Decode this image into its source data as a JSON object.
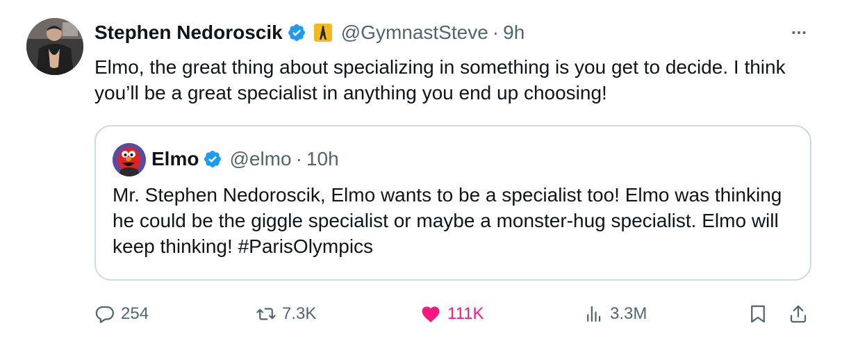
{
  "tweet": {
    "author": {
      "display_name": "Stephen Nedoroscik",
      "handle": "@GymnastSteve",
      "verified_icon": "verified-badge-icon",
      "affiliation_icon": "eiffel-tower-icon"
    },
    "separator": "·",
    "time": "9h",
    "more_icon": "more-horizontal-icon",
    "text": "Elmo, the great thing about specializing in something is you get to decide. I think you’ll be a great specialist in anything you end up choosing!"
  },
  "quoted_tweet": {
    "author": {
      "display_name": "Elmo",
      "handle": "@elmo",
      "verified_icon": "verified-badge-icon"
    },
    "separator": "·",
    "time": "10h",
    "text": "Mr. Stephen Nedoroscik, Elmo wants to be a specialist too! Elmo was thinking he could be the giggle specialist or maybe a monster-hug specialist. Elmo will keep thinking! #ParisOlympics"
  },
  "actions": {
    "reply": {
      "icon": "reply-icon",
      "count": "254"
    },
    "retweet": {
      "icon": "retweet-icon",
      "count": "7.3K"
    },
    "like": {
      "icon": "heart-filled-icon",
      "count": "111K",
      "liked": true
    },
    "views": {
      "icon": "views-chart-icon",
      "count": "3.3M"
    },
    "bookmark": {
      "icon": "bookmark-icon"
    },
    "share": {
      "icon": "share-icon"
    }
  },
  "colors": {
    "text_primary": "#0f1419",
    "text_secondary": "#536471",
    "verified_blue": "#1d9bf0",
    "like_pink": "#f91880",
    "border": "#cfd9de"
  }
}
